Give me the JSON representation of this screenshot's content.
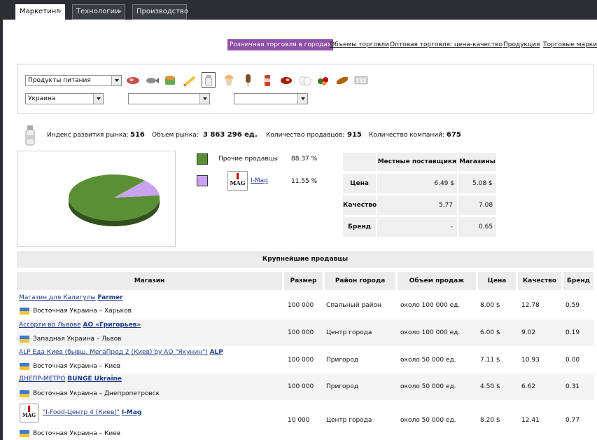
{
  "top_tabs": [
    {
      "label": "Маркетинг",
      "has_menu": true,
      "active": true
    },
    {
      "label": "Технологии",
      "has_menu": true,
      "active": false
    },
    {
      "label": "Производство",
      "has_menu": false,
      "active": false
    }
  ],
  "sub_nav": [
    {
      "label": "Розничная торговля в городах",
      "selected": true
    },
    {
      "label": "Объемы торговли",
      "selected": false
    },
    {
      "label": "Оптовая торговля: цена-качество",
      "selected": false
    },
    {
      "label": "Продукция",
      "selected": false
    },
    {
      "label": "Торговые марки",
      "selected": false
    }
  ],
  "filters": {
    "product_group": "Продукты питания",
    "country": "Украина",
    "region": "",
    "city": ""
  },
  "product_icons": [
    "sausage-icon",
    "fish-icon",
    "canned-food-icon",
    "cheese-icon",
    "milk-bottle-icon",
    "ice-cream-cup-icon",
    "ice-cream-stick-icon",
    "soft-drink-icon",
    "meat-icon",
    "eggs-icon",
    "vegetables-icon",
    "bread-icon",
    "egg-tray-icon"
  ],
  "stats": {
    "index_label": "Индекс развития рынка:",
    "index_value": "516",
    "volume_label": "Объем рынка:",
    "volume_value": "3 863 296 ед.",
    "sellers_label": "Количество продавцов:",
    "sellers_value": "915",
    "companies_label": "Количество компаний:",
    "companies_value": "675"
  },
  "chart_data": {
    "type": "pie",
    "series": [
      {
        "name": "Прочие продавцы",
        "value": 88.37,
        "color": "#5b8f36"
      },
      {
        "name": "I-Mag",
        "value": 11.55,
        "color": "#c9a2f0"
      }
    ]
  },
  "legend": [
    {
      "label": "Прочие продавцы",
      "percent": "88.37 %",
      "color": "#5b8f36",
      "is_link": false
    },
    {
      "label": "I-Mag",
      "percent": "11.55 %",
      "color": "#c9a2f0",
      "is_link": true
    }
  ],
  "comparison": {
    "headers": [
      "Местные поставщики",
      "Магазины"
    ],
    "rows": [
      {
        "label": "Цена",
        "local": "6.49 $",
        "shops": "5.08 $"
      },
      {
        "label": "Качество",
        "local": "5.77",
        "shops": "7.08"
      },
      {
        "label": "Бренд",
        "local": "-",
        "shops": "0.65"
      }
    ]
  },
  "sellers": {
    "title": "Крупнейшие продавцы",
    "headers": [
      "Магазин",
      "Размер",
      "Район города",
      "Объем продаж",
      "Цена",
      "Качество",
      "Бренд"
    ],
    "rows": [
      {
        "shop": "Магазин для Калигулы",
        "brand": "Farmer",
        "region": "Восточная Украина – Харьков",
        "size": "100 000",
        "district": "Спальный район",
        "volume": "около 100 000 ед.",
        "price": "8.00 $",
        "quality": "12.78",
        "brand_val": "0.59",
        "logo": false
      },
      {
        "shop": "Ассорти во Львове",
        "brand": "АО «Григорьев»",
        "region": "Западная Украина – Львов",
        "size": "100 000",
        "district": "Центр города",
        "volume": "около 100 000 ед.",
        "price": "6.00 $",
        "quality": "9.02",
        "brand_val": "0.19",
        "logo": false
      },
      {
        "shop": "ALP Еда Киев (бывш. МегаПрод 2 (Киев) by АО \"Якунин\")",
        "brand": "ALP",
        "region": "Восточная Украина – Киев",
        "size": "100 000",
        "district": "Пригород",
        "volume": "около 50 000 ед.",
        "price": "7.11 $",
        "quality": "10.93",
        "brand_val": "0.00",
        "logo": false
      },
      {
        "shop": "ДНЕПР-МЕТРО",
        "brand": "BUNGE Ukraine",
        "region": "Восточная Украина – Днепропетровск",
        "size": "100 000",
        "district": "Пригород",
        "volume": "около 50 000 ед.",
        "price": "4.50 $",
        "quality": "6.62",
        "brand_val": "0.31",
        "logo": false
      },
      {
        "shop": "\"I-Food-Центр 4 (Киев)\"",
        "brand": "I-Mag",
        "region": "Восточная Украина – Киев",
        "size": "10 000",
        "district": "Центр города",
        "volume": "около 50 000 ед.",
        "price": "8.20 $",
        "quality": "12.41",
        "brand_val": "0.77",
        "logo": true
      }
    ]
  },
  "logo_text": "MAG"
}
